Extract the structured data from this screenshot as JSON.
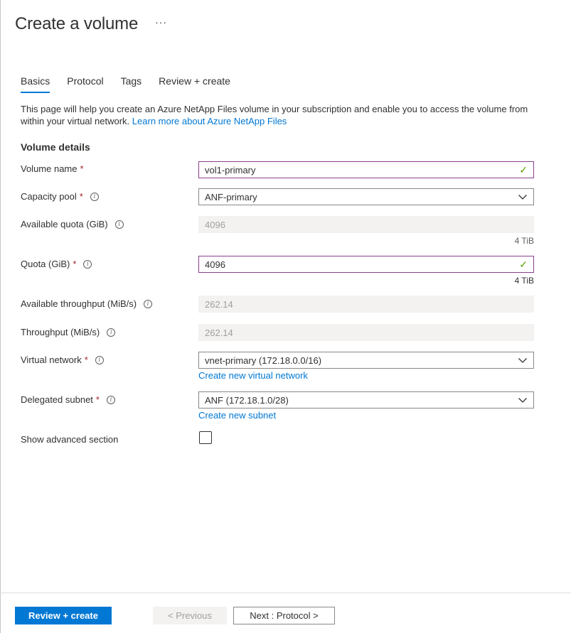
{
  "page": {
    "title": "Create a volume",
    "more_label": "···"
  },
  "tabs": [
    {
      "label": "Basics",
      "active": true
    },
    {
      "label": "Protocol",
      "active": false
    },
    {
      "label": "Tags",
      "active": false
    },
    {
      "label": "Review + create",
      "active": false
    }
  ],
  "intro": {
    "text": "This page will help you create an Azure NetApp Files volume in your subscription and enable you to access the volume from within your virtual network.",
    "link": "Learn more about Azure NetApp Files"
  },
  "section": {
    "title": "Volume details"
  },
  "fields": {
    "volume_name": {
      "label": "Volume name",
      "required": "*",
      "value": "vol1-primary"
    },
    "capacity_pool": {
      "label": "Capacity pool",
      "required": "*",
      "value": "ANF-primary"
    },
    "available_quota": {
      "label": "Available quota (GiB)",
      "value": "4096",
      "hint": "4 TiB"
    },
    "quota": {
      "label": "Quota (GiB)",
      "required": "*",
      "value": "4096",
      "hint": "4 TiB"
    },
    "available_throughput": {
      "label": "Available throughput (MiB/s)",
      "value": "262.14"
    },
    "throughput": {
      "label": "Throughput (MiB/s)",
      "value": "262.14"
    },
    "virtual_network": {
      "label": "Virtual network",
      "required": "*",
      "value": "vnet-primary (172.18.0.0/16)",
      "link": "Create new virtual network"
    },
    "delegated_subnet": {
      "label": "Delegated subnet",
      "required": "*",
      "value": "ANF (172.18.1.0/28)",
      "link": "Create new subnet"
    },
    "show_advanced": {
      "label": "Show advanced section",
      "checked": false
    }
  },
  "info_glyph": "i",
  "check_glyph": "✓",
  "footer": {
    "review_create": "Review + create",
    "previous": "< Previous",
    "next": "Next : Protocol >"
  },
  "colors": {
    "accent": "#0078d4",
    "valid_border": "#8a3f8f",
    "check": "#57a300",
    "required": "#a4262c"
  },
  "icons": [
    "more-icon",
    "info-icon",
    "checkmark-icon",
    "chevron-down-icon"
  ]
}
